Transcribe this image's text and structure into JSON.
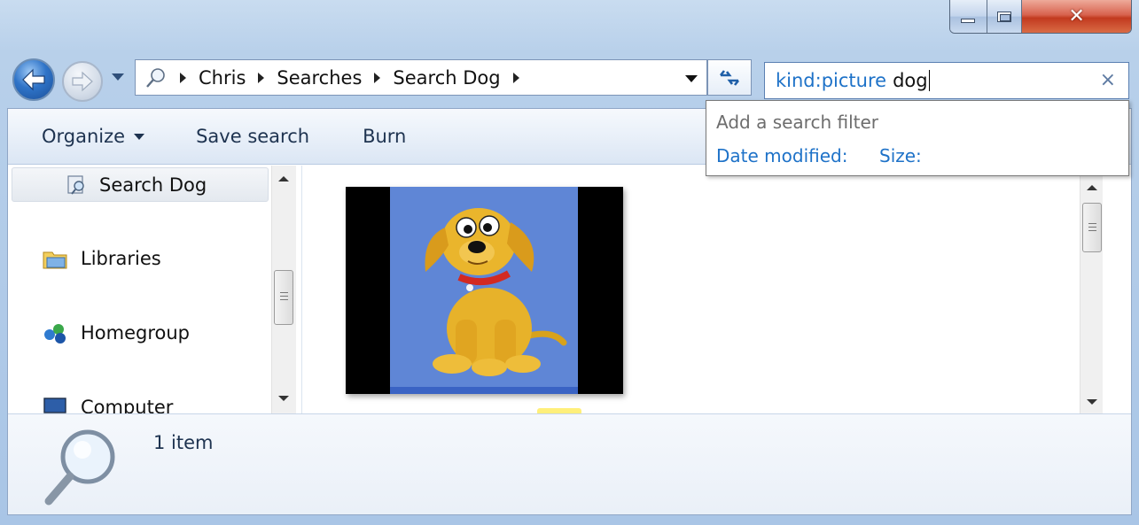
{
  "window": {
    "caption": {
      "minimize": "minimize-icon",
      "maximize": "maximize-icon",
      "close": "✕"
    }
  },
  "nav": {
    "back": "back-arrow-icon",
    "forward": "forward-arrow-icon"
  },
  "address": {
    "crumbs": [
      "Chris",
      "Searches",
      "Search Dog"
    ]
  },
  "search": {
    "kind_token": "kind:picture",
    "term": "dog",
    "clear": "×"
  },
  "filter_dropdown": {
    "title": "Add a search filter",
    "options": [
      "Date modified:",
      "Size:"
    ]
  },
  "toolbar": {
    "organize": "Organize",
    "save_search": "Save search",
    "burn": "Burn"
  },
  "navpane": {
    "selected": "Search Dog",
    "items": [
      "Libraries",
      "Homegroup",
      "Computer"
    ]
  },
  "details": {
    "count": "1 item"
  },
  "colors": {
    "accent": "#1e72c8",
    "frame": "#b8d0ea",
    "close": "#c23a1f"
  }
}
